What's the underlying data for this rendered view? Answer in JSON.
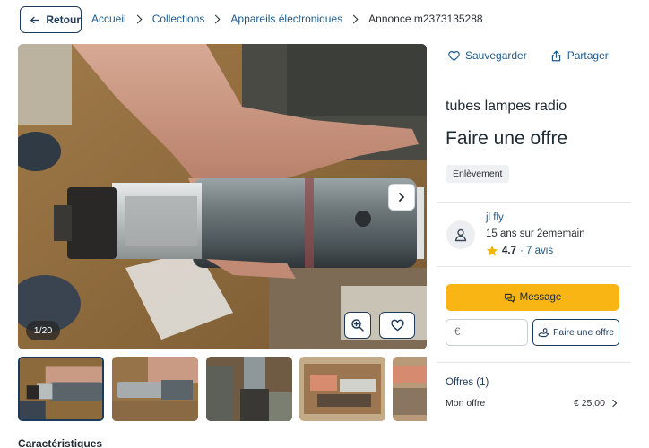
{
  "header": {
    "back_label": "Retour",
    "breadcrumbs": [
      "Accueil",
      "Collections",
      "Appareils électroniques",
      "Annonce m2373135288"
    ]
  },
  "gallery": {
    "counter": "1/20",
    "thumbnail_count": 5
  },
  "listing": {
    "save_label": "Sauvegarder",
    "share_label": "Partager",
    "title": "tubes lampes radio",
    "heading": "Faire une offre",
    "badge": "Enlèvement",
    "section_title": "Caractéristiques"
  },
  "seller": {
    "name": "jl fly",
    "since": "15 ans sur 2ememain",
    "rating": "4.7",
    "reviews": "· 7 avis"
  },
  "contact": {
    "message_label": "Message",
    "euro_placeholder": "€",
    "offer_button_label": "Faire une offre"
  },
  "offers": {
    "title": "Offres (1)",
    "my_offer_label": "Mon offre",
    "my_offer_amount": "€ 25,00"
  },
  "colors": {
    "accent_yellow": "#f8b514",
    "navy": "#1e3a5a",
    "link_blue": "#1d5a8c",
    "star": "#f2b705"
  },
  "icons": [
    "arrow-left-icon",
    "chevron-right-icon",
    "heart-icon",
    "share-icon",
    "zoom-icon",
    "user-icon",
    "star-icon",
    "chat-icon",
    "hand-offer-icon"
  ]
}
